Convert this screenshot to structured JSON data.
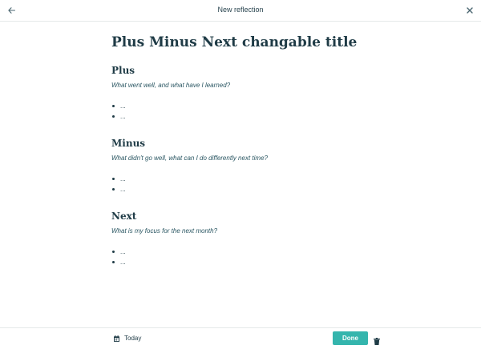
{
  "header": {
    "title": "New reflection",
    "back_icon": "arrow-left-icon",
    "close_icon": "close-icon"
  },
  "document": {
    "title": "Plus Minus Next changable title",
    "sections": [
      {
        "heading": "Plus",
        "prompt": "What went well, and what have I learned?",
        "bullets": [
          "...",
          "..."
        ]
      },
      {
        "heading": "Minus",
        "prompt": "What didn't go well, what can I do differently next time?",
        "bullets": [
          "...",
          "..."
        ]
      },
      {
        "heading": "Next",
        "prompt": "What is my focus for the next month?",
        "bullets": [
          "...",
          "..."
        ]
      }
    ]
  },
  "footer": {
    "date_label": "Today",
    "date_icon": "calendar-icon",
    "done_label": "Done",
    "delete_icon": "trash-icon"
  },
  "colors": {
    "accent": "#34b5ad",
    "text": "#1f3b46",
    "prompt_text": "#2b5763",
    "divider": "#e6e9ea"
  }
}
